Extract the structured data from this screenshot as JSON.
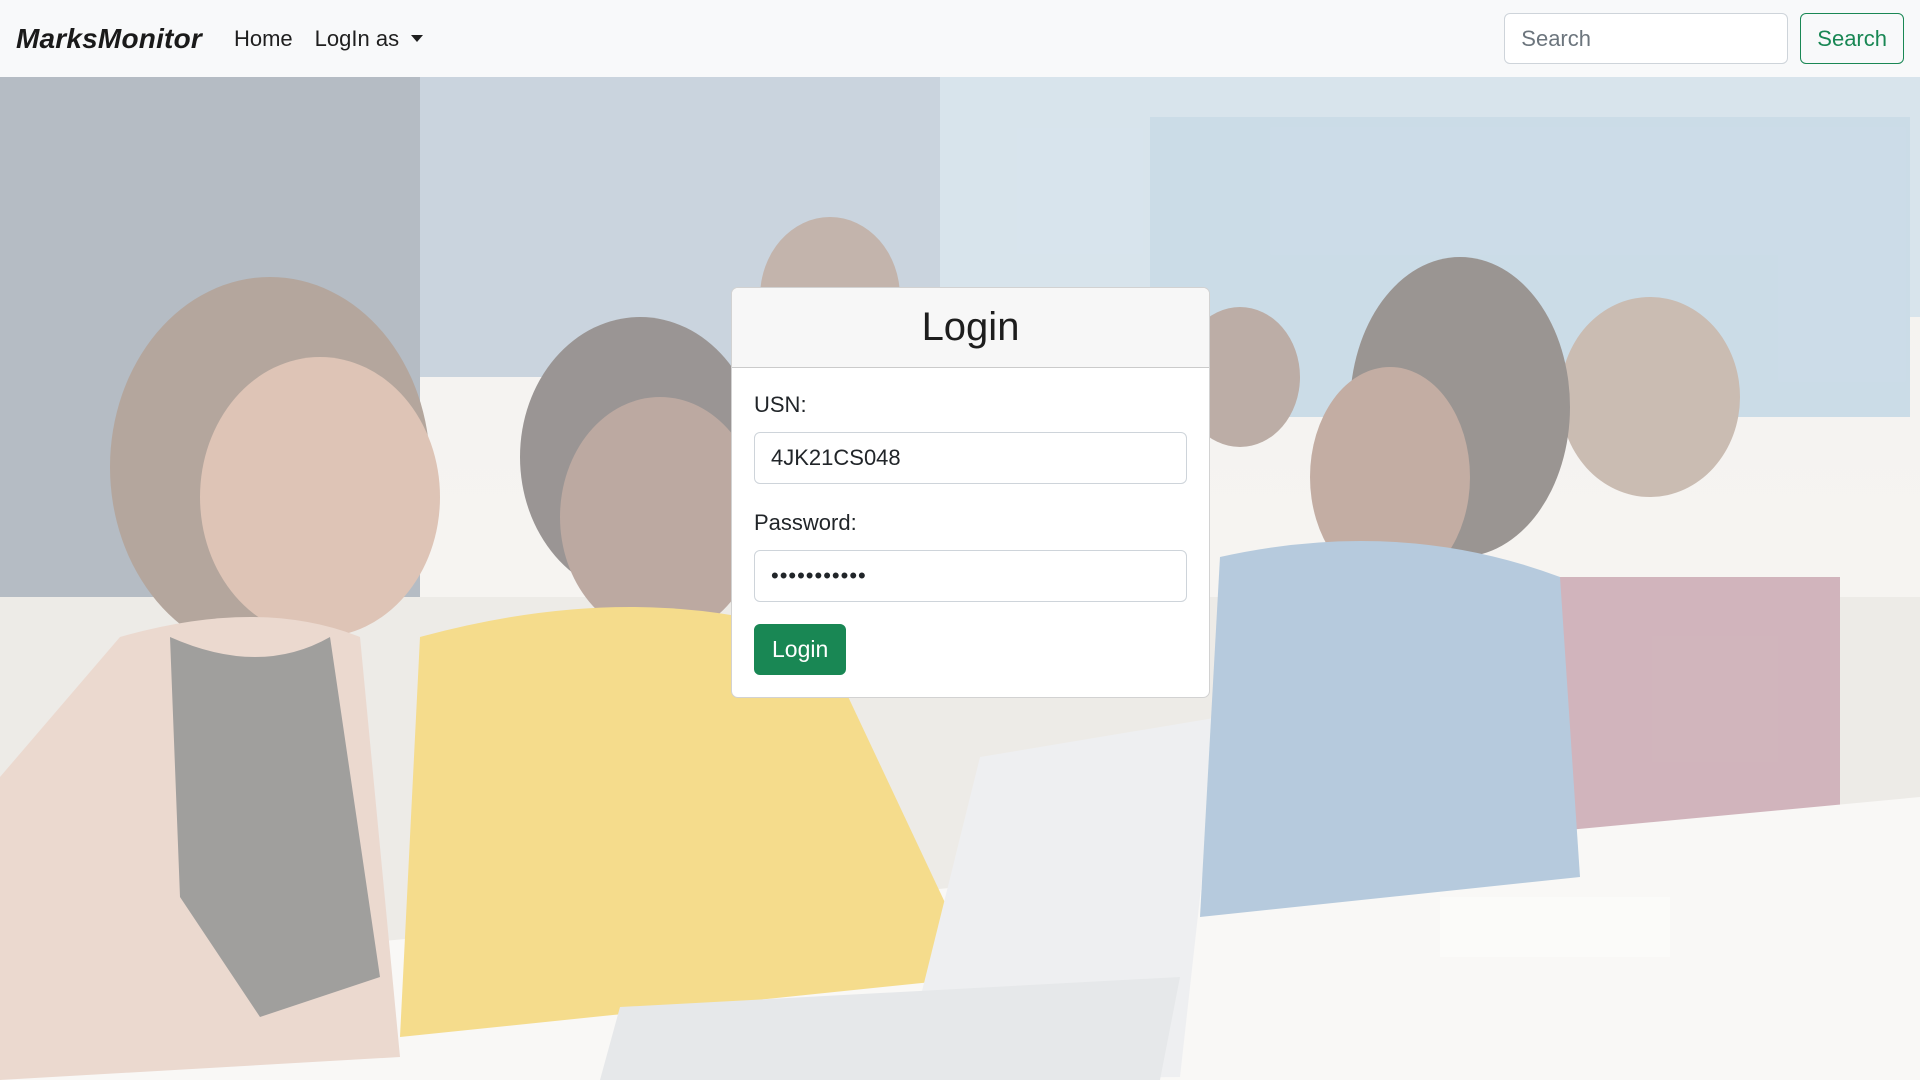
{
  "navbar": {
    "brand": "MarksMonitor",
    "links": [
      {
        "label": "Home"
      },
      {
        "label": "LogIn as"
      }
    ],
    "search": {
      "placeholder": "Search",
      "button_label": "Search"
    }
  },
  "login_card": {
    "title": "Login",
    "usn_label": "USN:",
    "usn_value": "4JK21CS048",
    "password_label": "Password:",
    "password_value": "secret12345",
    "submit_label": "Login"
  },
  "colors": {
    "accent": "#198754",
    "navbar_bg": "#f8f9fa"
  },
  "icons": {
    "dropdown": "caret-down-icon"
  }
}
